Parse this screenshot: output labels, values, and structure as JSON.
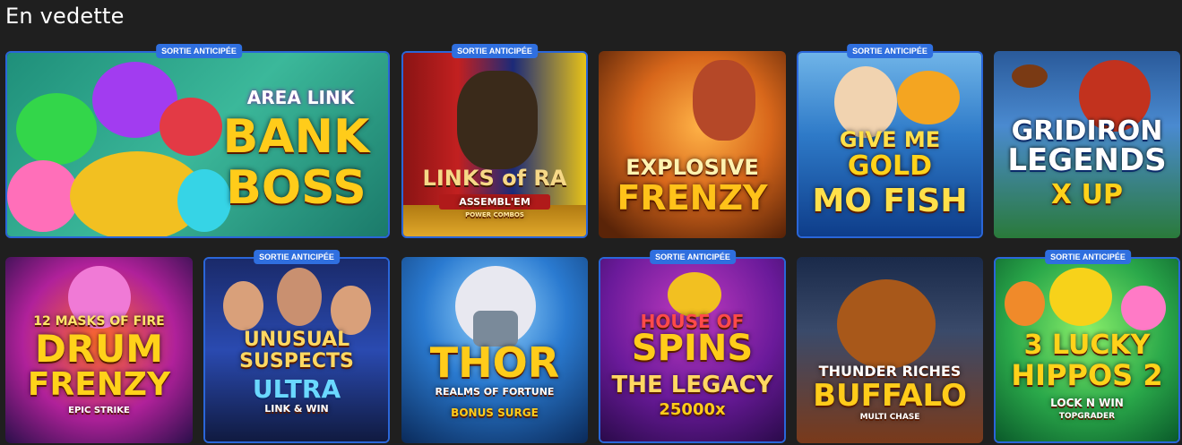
{
  "section": {
    "title": "En vedette"
  },
  "badge_label": "SORTIE ANTICIPÉE",
  "games": [
    {
      "id": "bank-boss",
      "line1": "AREA LINK",
      "line2": "BANK",
      "line3": "BOSS",
      "early": true
    },
    {
      "id": "links-of-ra",
      "line1": "LINKS of RA",
      "line2": "ASSEMBL'EM",
      "line3": "POWER COMBOS",
      "early": true
    },
    {
      "id": "explosive-frenzy",
      "line1": "EXPLOSIVE",
      "line2": "FRENZY",
      "early": false
    },
    {
      "id": "give-me-gold",
      "line1": "GIVE ME",
      "line2": "GOLD",
      "line3": "MO FISH",
      "early": true
    },
    {
      "id": "gridiron-legends",
      "line1": "GRIDIRON",
      "line2": "LEGENDS",
      "line3": "X UP",
      "early": false
    },
    {
      "id": "drum-frenzy",
      "line1": "12 MASKS OF FIRE",
      "line2": "DRUM",
      "line3": "FRENZY",
      "line4": "EPIC STRIKE",
      "early": false
    },
    {
      "id": "unusual-suspects",
      "line1": "UNUSUAL",
      "line2": "SUSPECTS",
      "line3": "ULTRA",
      "line4": "LINK & WIN",
      "early": true
    },
    {
      "id": "thor",
      "line1": "THOR",
      "line2": "REALMS OF FORTUNE",
      "line3": "BONUS SURGE",
      "early": false
    },
    {
      "id": "house-of-spins",
      "line1": "HOUSE OF",
      "line2": "SPINS",
      "line3": "THE LEGACY",
      "line4": "25000x",
      "early": true
    },
    {
      "id": "thunder-riches",
      "line1": "THUNDER RICHES",
      "line2": "BUFFALO",
      "line3": "MULTI CHASE",
      "early": false
    },
    {
      "id": "3-lucky-hippos",
      "line1": "3 LUCKY",
      "line2": "HIPPOS 2",
      "line3": "LOCK N WIN",
      "line4": "TOPGRADER",
      "early": true
    }
  ]
}
